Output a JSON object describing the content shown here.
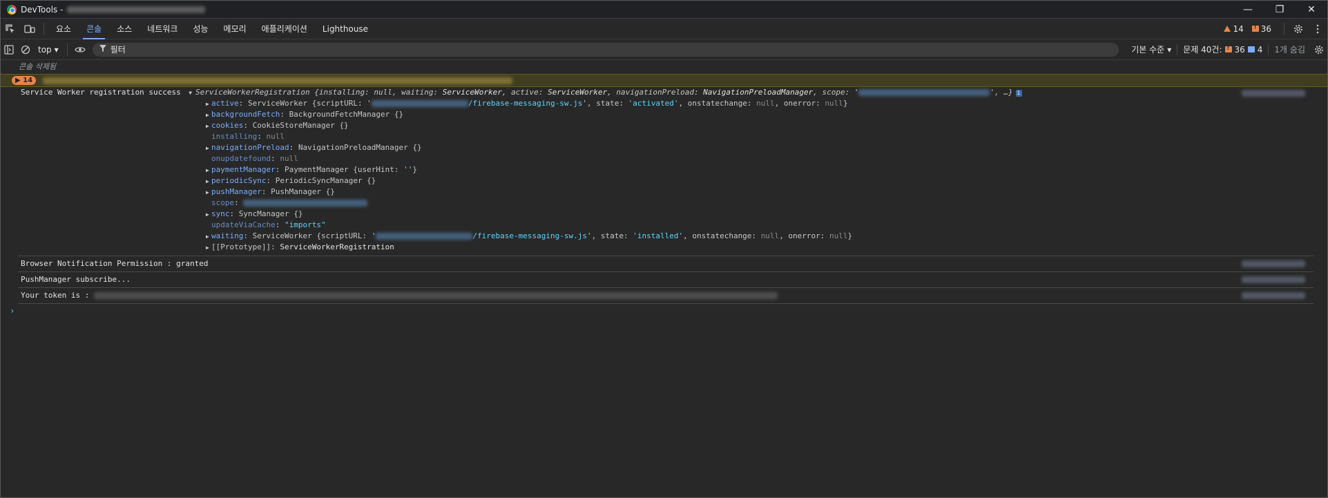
{
  "window": {
    "title": "DevTools -",
    "controls": {
      "minimize": "—",
      "restore": "❐",
      "close": "✕"
    }
  },
  "tabs": [
    {
      "label": "요소",
      "active": false
    },
    {
      "label": "콘솔",
      "active": true
    },
    {
      "label": "소스",
      "active": false
    },
    {
      "label": "네트워크",
      "active": false
    },
    {
      "label": "성능",
      "active": false
    },
    {
      "label": "메모리",
      "active": false
    },
    {
      "label": "애플리케이션",
      "active": false
    },
    {
      "label": "Lighthouse",
      "active": false
    }
  ],
  "header_counts": {
    "warnings": "14",
    "errors": "36"
  },
  "toolbar": {
    "context": "top",
    "filter_placeholder": "필터",
    "levels": "기본 수준",
    "issues_label": "문제 40건:",
    "issues_warn": "36",
    "issues_info": "4",
    "hidden": "1개 숨김"
  },
  "console": {
    "cleared": "콘솔 삭제됨",
    "warn_group_count": "14",
    "sw_log": {
      "message": "Service Worker registration success",
      "summary_class": "ServiceWorkerRegistration",
      "summary_parts": [
        {
          "k": "installing",
          "v": "null"
        },
        {
          "k": "waiting",
          "v": "ServiceWorker"
        },
        {
          "k": "active",
          "v": "ServiceWorker"
        },
        {
          "k": "navigationPreload",
          "v": "NavigationPreloadManager"
        },
        {
          "k": "scope",
          "v": ""
        }
      ],
      "summary_tail": "', …}",
      "properties": {
        "active_key": "active",
        "active_val_prefix": "ServiceWorker {scriptURL: '",
        "active_script": "/firebase-messaging-sw.js",
        "active_state_prefix": "', state: ",
        "active_state": "'activated'",
        "active_tail_1": ", onstatechange: ",
        "active_null1": "null",
        "active_tail_2": ", onerror: ",
        "active_null2": "null",
        "active_close": "}",
        "bgfetch_key": "backgroundFetch",
        "bgfetch_val": "BackgroundFetchManager {}",
        "cookies_key": "cookies",
        "cookies_val": "CookieStoreManager {}",
        "installing_key": "installing",
        "installing_val": "null",
        "navpreload_key": "navigationPreload",
        "navpreload_val": "NavigationPreloadManager {}",
        "onupdatefound_key": "onupdatefound",
        "onupdatefound_val": "null",
        "payment_key": "paymentManager",
        "payment_val_prefix": "PaymentManager {userHint: ",
        "payment_hint": "''",
        "payment_close": "}",
        "periodic_key": "periodicSync",
        "periodic_val": "PeriodicSyncManager {}",
        "push_key": "pushManager",
        "push_val": "PushManager {}",
        "scope_key": "scope",
        "sync_key": "sync",
        "sync_val": "SyncManager {}",
        "updatevia_key": "updateViaCache",
        "updatevia_val": "\"imports\"",
        "waiting_key": "waiting",
        "waiting_val_prefix": "ServiceWorker {scriptURL: '",
        "waiting_script": "/firebase-messaging-sw.js",
        "waiting_state_prefix": "', state: ",
        "waiting_state": "'installed'",
        "waiting_tail_1": ", onstatechange: ",
        "waiting_null1": "null",
        "waiting_tail_2": ", onerror: ",
        "waiting_null2": "null",
        "waiting_close": "}",
        "proto_key": "[[Prototype]]",
        "proto_val": "ServiceWorkerRegistration"
      }
    },
    "notif_log": "Browser Notification Permission : granted",
    "push_log": "PushManager subscribe...",
    "token_log": "Your token is :",
    "prompt": "›"
  }
}
